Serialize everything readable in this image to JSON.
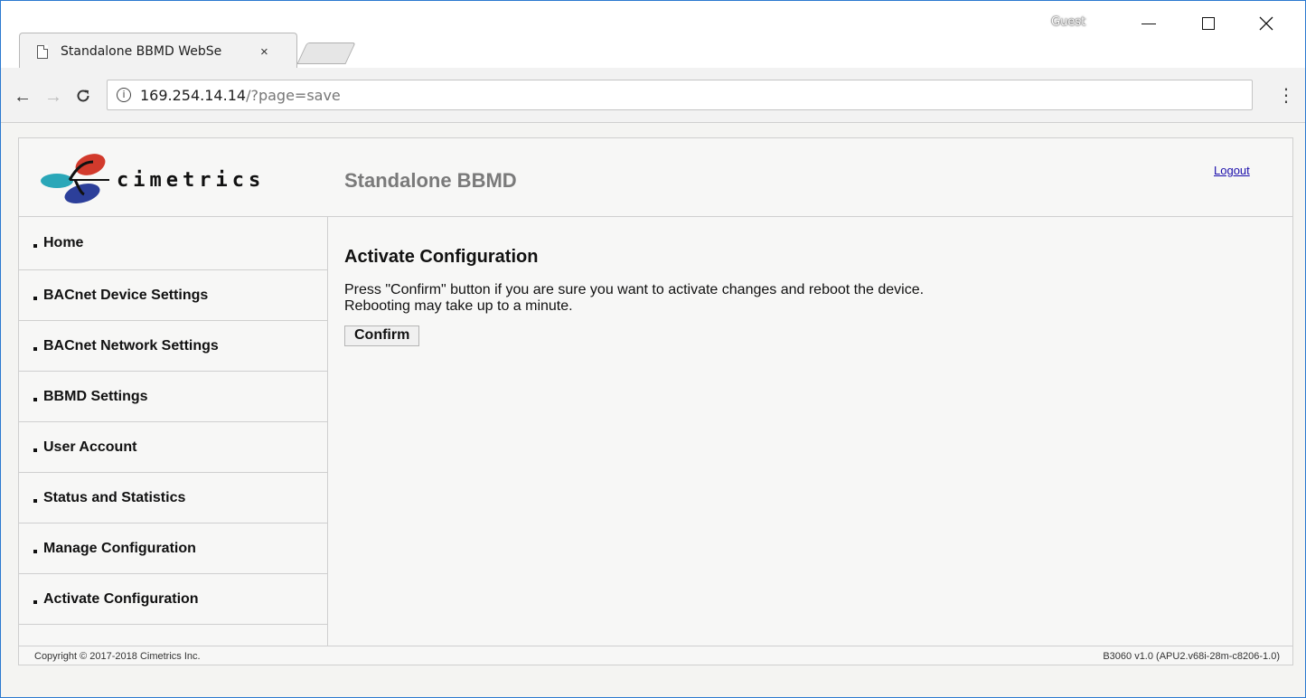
{
  "browser": {
    "tab_title": "Standalone BBMD WebSe",
    "tab_close": "×",
    "profile_label": "Guest",
    "url_host": "169.254.14.14",
    "url_path": "/?page=save",
    "info_icon": "ⓘ",
    "menu_icon": "⋮"
  },
  "header": {
    "logo_text": "cimetrics",
    "title": "Standalone BBMD",
    "logout_label": "Logout"
  },
  "sidebar": {
    "items": [
      {
        "label": "Home"
      },
      {
        "label": "BACnet Device Settings"
      },
      {
        "label": "BACnet Network Settings"
      },
      {
        "label": "BBMD Settings"
      },
      {
        "label": "User Account"
      },
      {
        "label": "Status and Statistics"
      },
      {
        "label": "Manage Configuration"
      },
      {
        "label": "Activate Configuration"
      }
    ]
  },
  "main": {
    "heading": "Activate Configuration",
    "line1": "Press \"Confirm\" button if you are sure you want to activate changes and reboot the device.",
    "line2": "Rebooting may take up to a minute.",
    "confirm_label": "Confirm"
  },
  "footer": {
    "copyright": "Copyright © 2017-2018 Cimetrics Inc.",
    "version": "B3060 v1.0 (APU2.v68i-28m-c8206-1.0)"
  },
  "colors": {
    "window_border": "#2b79d0",
    "link": "#1a0dab",
    "title_gray": "#7a7a7a",
    "logo_teal": "#2aa7b8",
    "logo_red": "#d23a2c",
    "logo_blue": "#2c3f9a"
  }
}
